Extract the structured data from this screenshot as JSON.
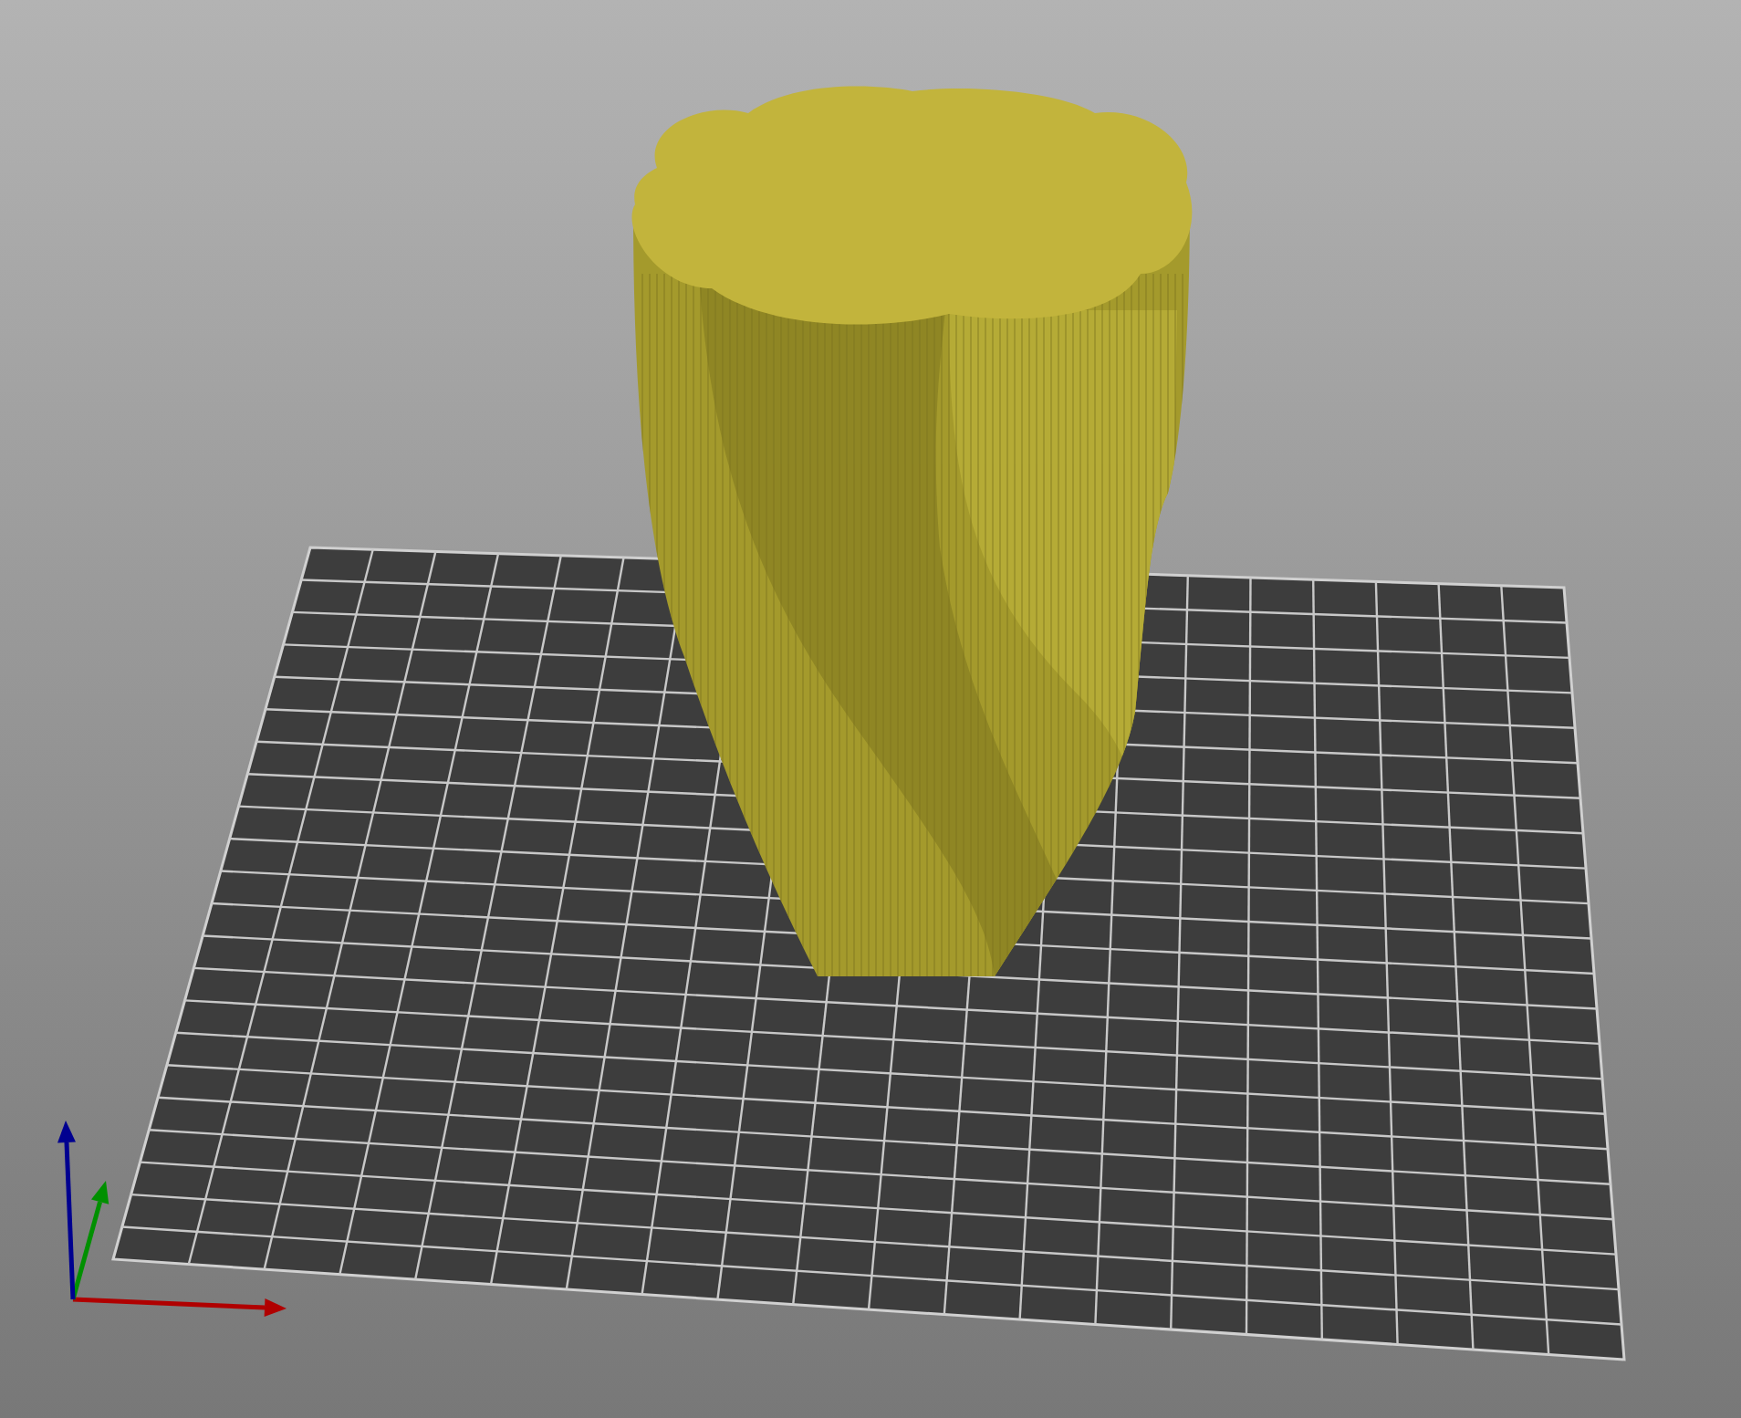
{
  "scene": {
    "kind": "perspective",
    "axes": [
      {
        "kind": "x",
        "color": "#b00000"
      },
      {
        "kind": "y",
        "color": "#009000"
      },
      {
        "kind": "z",
        "color": "#000090"
      }
    ]
  }
}
